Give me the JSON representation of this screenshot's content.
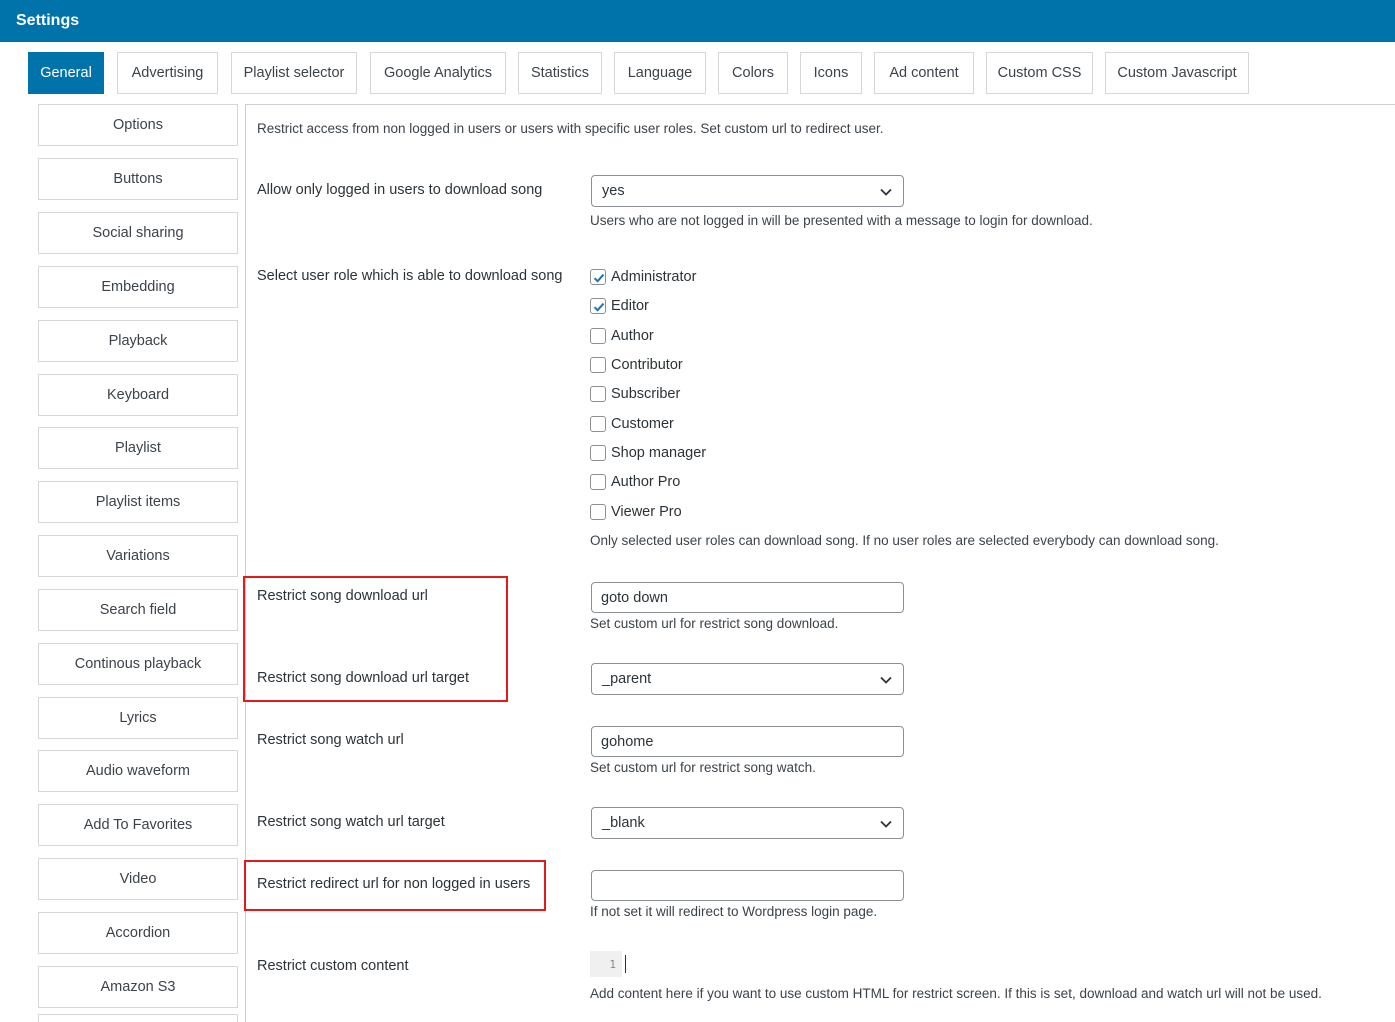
{
  "header": {
    "title": "Settings"
  },
  "tabs": [
    {
      "label": "General",
      "active": true
    },
    {
      "label": "Advertising",
      "active": false
    },
    {
      "label": "Playlist selector",
      "active": false
    },
    {
      "label": "Google Analytics",
      "active": false
    },
    {
      "label": "Statistics",
      "active": false
    },
    {
      "label": "Language",
      "active": false
    },
    {
      "label": "Colors",
      "active": false
    },
    {
      "label": "Icons",
      "active": false
    },
    {
      "label": "Ad content",
      "active": false
    },
    {
      "label": "Custom CSS",
      "active": false
    },
    {
      "label": "Custom Javascript",
      "active": false
    }
  ],
  "sidebar": {
    "items": [
      {
        "label": "Options"
      },
      {
        "label": "Buttons"
      },
      {
        "label": "Social sharing"
      },
      {
        "label": "Embedding"
      },
      {
        "label": "Playback"
      },
      {
        "label": "Keyboard"
      },
      {
        "label": "Playlist"
      },
      {
        "label": "Playlist items"
      },
      {
        "label": "Variations"
      },
      {
        "label": "Search field"
      },
      {
        "label": "Continous playback"
      },
      {
        "label": "Lyrics"
      },
      {
        "label": "Audio waveform"
      },
      {
        "label": "Add To Favorites"
      },
      {
        "label": "Video"
      },
      {
        "label": "Accordion"
      },
      {
        "label": "Amazon S3"
      }
    ]
  },
  "main": {
    "intro": "Restrict access from non logged in users or users with specific user roles. Set custom url to redirect user.",
    "logged_only": {
      "label": "Allow only logged in users to download song",
      "value": "yes",
      "description": "Users who are not logged in will be presented with a message to login for download."
    },
    "roles": {
      "label": "Select user role which is able to download song",
      "options": [
        {
          "label": "Administrator",
          "checked": true
        },
        {
          "label": "Editor",
          "checked": true
        },
        {
          "label": "Author",
          "checked": false
        },
        {
          "label": "Contributor",
          "checked": false
        },
        {
          "label": "Subscriber",
          "checked": false
        },
        {
          "label": "Customer",
          "checked": false
        },
        {
          "label": "Shop manager",
          "checked": false
        },
        {
          "label": "Author Pro",
          "checked": false
        },
        {
          "label": "Viewer Pro",
          "checked": false
        }
      ],
      "description": "Only selected user roles can download song. If no user roles are selected everybody can download song."
    },
    "download_url": {
      "label": "Restrict song download url",
      "value": "goto down",
      "description": "Set custom url for restrict song download."
    },
    "download_target": {
      "label": "Restrict song download url target",
      "value": "_parent"
    },
    "watch_url": {
      "label": "Restrict song watch url",
      "value": "gohome",
      "description": "Set custom url for restrict song watch."
    },
    "watch_target": {
      "label": "Restrict song watch url target",
      "value": "_blank"
    },
    "redirect_url": {
      "label": "Restrict redirect url for non logged in users",
      "value": "",
      "description": "If not set it will redirect to Wordpress login page."
    },
    "custom_content": {
      "label": "Restrict custom content",
      "line_number": "1",
      "description": "Add content here if you want to use custom HTML for restrict screen. If this is set, download and watch url will not be used."
    }
  },
  "colors": {
    "accent": "#0073aa",
    "highlight_box": "#e31b1b",
    "checkbox_check": "#2271b1"
  }
}
